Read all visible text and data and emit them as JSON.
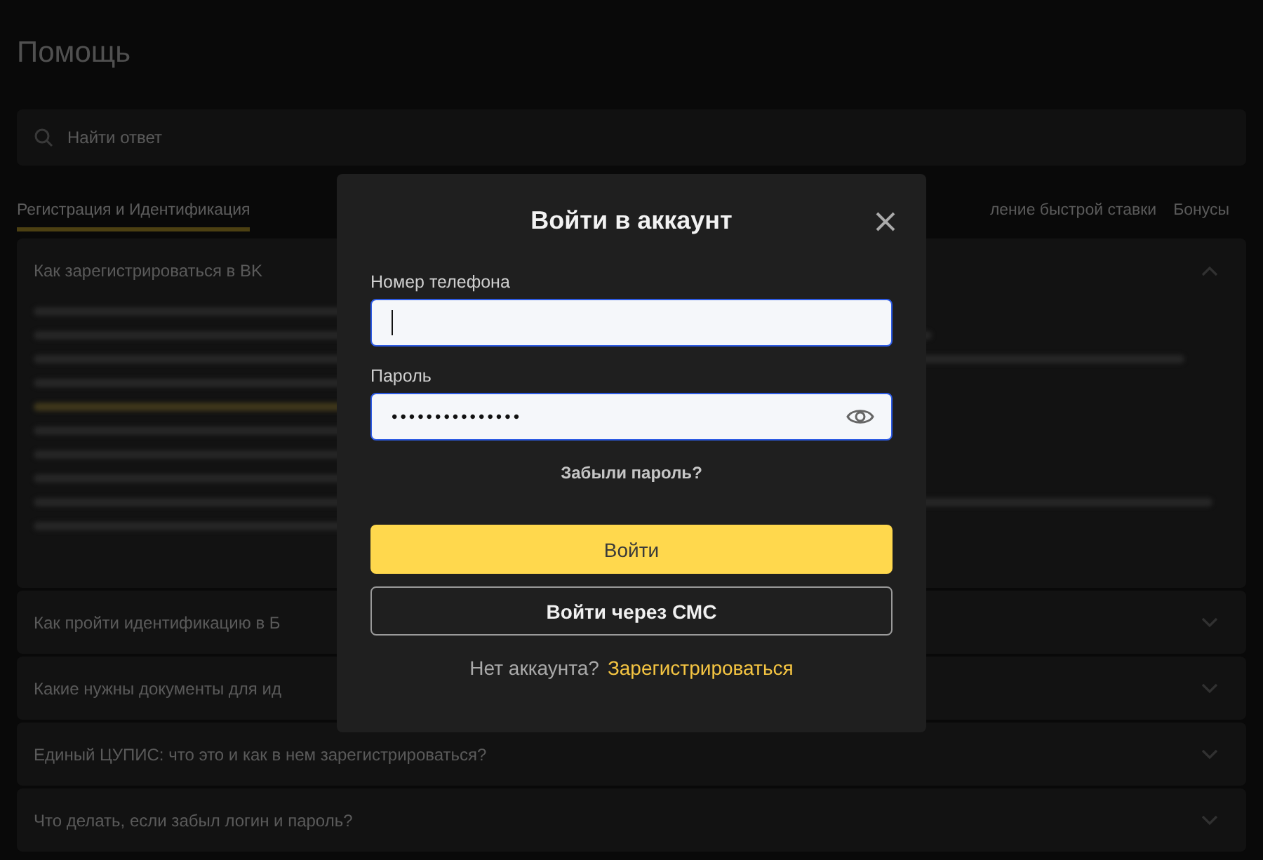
{
  "page": {
    "title": "Помощь",
    "search": {
      "placeholder": "Найти ответ"
    },
    "tabs": [
      {
        "label": "Регистрация и Идентификация",
        "selected": true
      },
      {
        "label": "ление быстрой ставки",
        "selected": false
      },
      {
        "label": "Бонусы",
        "selected": false
      }
    ],
    "questions": [
      {
        "text": "Как зарегистрироваться в BK",
        "expanded": true
      },
      {
        "text": "Как пройти идентификацию в Б",
        "expanded": false
      },
      {
        "text": "Какие нужны документы для ид",
        "expanded": false
      },
      {
        "text": "Единый ЦУПИС: что это и как в нем зарегистрироваться?",
        "expanded": false
      },
      {
        "text": "Что делать, если забыл логин и пароль?",
        "expanded": false
      }
    ]
  },
  "dialog": {
    "title": "Войти в аккаунт",
    "fields": [
      {
        "label": "Номер телефона",
        "focused": true,
        "kind": "text"
      },
      {
        "label": "Пароль",
        "value": "•••••••••••••••",
        "focused": false,
        "kind": "password"
      }
    ],
    "forgot_link": "Забыли пароль?",
    "buttons": [
      {
        "label": "Войти",
        "kind": "primary"
      },
      {
        "label": "Войти через СМС",
        "kind": "outline"
      }
    ],
    "signup_prompt": "Нет аккаунта?",
    "signup_link": "Зарегистрироваться"
  }
}
